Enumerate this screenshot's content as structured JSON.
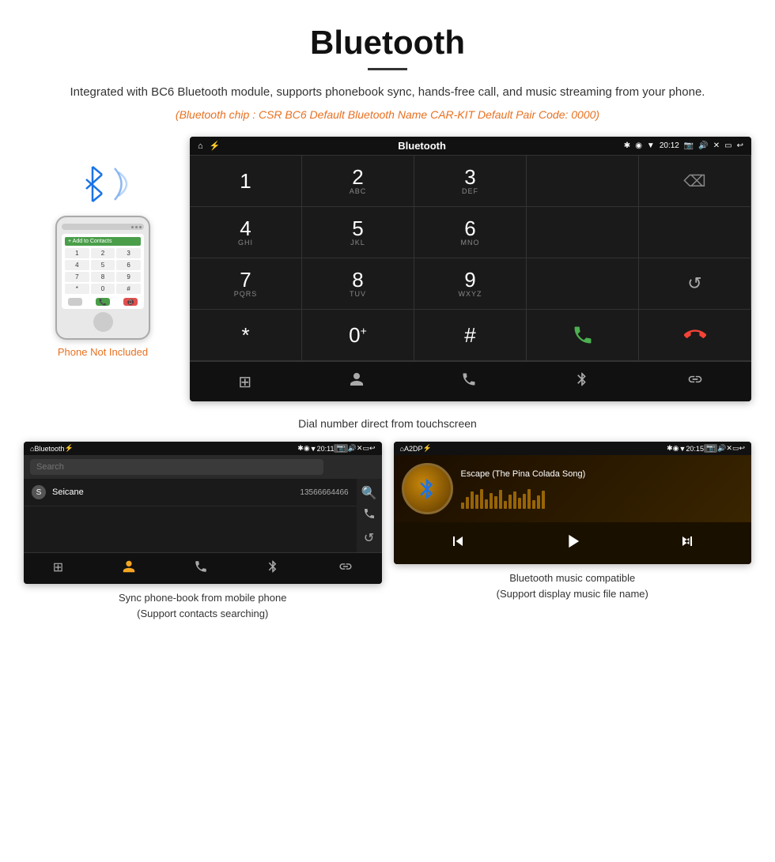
{
  "header": {
    "title": "Bluetooth",
    "divider": true,
    "description": "Integrated with BC6 Bluetooth module, supports phonebook sync, hands-free call, and music streaming from your phone.",
    "tech_info": "(Bluetooth chip : CSR BC6    Default Bluetooth Name CAR-KIT    Default Pair Code: 0000)"
  },
  "phone_label": "Phone Not Included",
  "head_unit": {
    "status_bar": {
      "title": "Bluetooth",
      "time": "20:12",
      "icons": [
        "bluetooth",
        "location",
        "wifi",
        "camera",
        "volume",
        "close",
        "window",
        "back"
      ]
    },
    "dialpad": {
      "keys": [
        {
          "num": "1",
          "sub": ""
        },
        {
          "num": "2",
          "sub": "ABC"
        },
        {
          "num": "3",
          "sub": "DEF"
        },
        {
          "num": "",
          "sub": ""
        },
        {
          "num": "⌫",
          "sub": ""
        },
        {
          "num": "4",
          "sub": "GHI"
        },
        {
          "num": "5",
          "sub": "JKL"
        },
        {
          "num": "6",
          "sub": "MNO"
        },
        {
          "num": "",
          "sub": ""
        },
        {
          "num": "",
          "sub": ""
        },
        {
          "num": "7",
          "sub": "PQRS"
        },
        {
          "num": "8",
          "sub": "TUV"
        },
        {
          "num": "9",
          "sub": "WXYZ"
        },
        {
          "num": "",
          "sub": ""
        },
        {
          "num": "↺",
          "sub": ""
        },
        {
          "num": "*",
          "sub": ""
        },
        {
          "num": "0",
          "sub": "+"
        },
        {
          "num": "#",
          "sub": ""
        },
        {
          "num": "✆",
          "sub": "green"
        },
        {
          "num": "✆",
          "sub": "red"
        }
      ]
    },
    "toolbar": [
      "⊞",
      "👤",
      "✆",
      "✱",
      "🔗"
    ]
  },
  "dial_caption": "Dial number direct from touchscreen",
  "phonebook": {
    "status_bar": {
      "title": "Bluetooth",
      "time": "20:11"
    },
    "search_placeholder": "Search",
    "contact": {
      "letter": "S",
      "name": "Seicane",
      "phone": "13566664466"
    },
    "toolbar": [
      "⊞",
      "👤",
      "✆",
      "✱",
      "🔗"
    ]
  },
  "phonebook_caption_line1": "Sync phone-book from mobile phone",
  "phonebook_caption_line2": "(Support contacts searching)",
  "music": {
    "status_bar": {
      "title": "A2DP",
      "time": "20:15"
    },
    "song_title": "Escape (The Pina Colada Song)",
    "eq_bars": [
      8,
      15,
      22,
      18,
      25,
      12,
      20,
      16,
      24,
      10,
      18,
      22,
      14,
      19,
      25,
      11,
      17,
      23
    ],
    "controls": [
      "prev",
      "play-pause",
      "next"
    ]
  },
  "music_caption_line1": "Bluetooth music compatible",
  "music_caption_line2": "(Support display music file name)"
}
